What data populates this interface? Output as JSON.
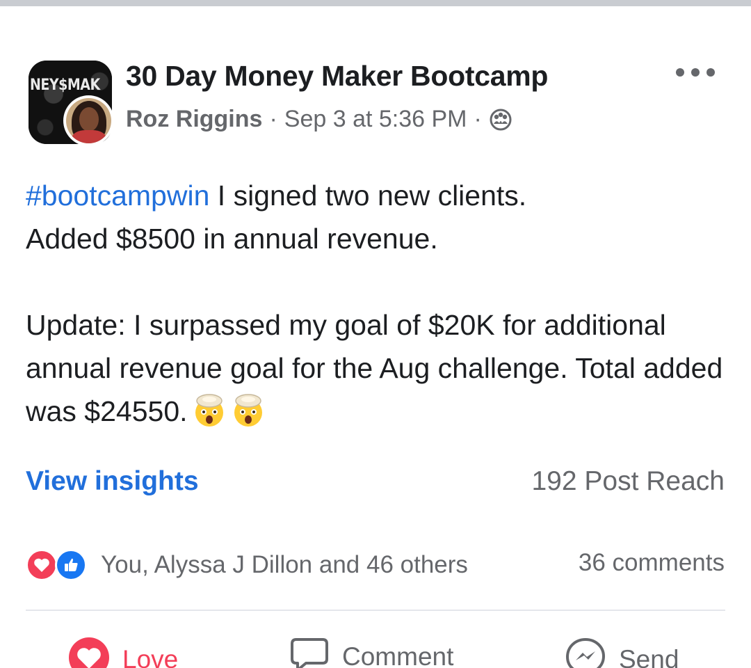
{
  "post": {
    "group_name": "30 Day Money Maker Bootcamp",
    "group_avatar_text": "NEY$MAK",
    "author": "Roz Riggins",
    "separator": "·",
    "timestamp": "Sep 3 at 5:36 PM",
    "privacy_icon": "group-icon",
    "hashtag": "#bootcampwin",
    "line1_rest": " I signed two new clients.",
    "line2": "Added $8500 in annual revenue.",
    "update_text": "Update: I surpassed my goal of $20K for additional annual revenue goal for the Aug challenge. Total added was $24550.",
    "emoji": [
      "exploding-head-emoji",
      "exploding-head-emoji"
    ]
  },
  "insights": {
    "link_label": "View insights",
    "post_reach": "192 Post Reach"
  },
  "reactions": {
    "icons": [
      "love-reaction-icon",
      "like-reaction-icon"
    ],
    "names": "You, Alyssa J Dillon and 46 others",
    "comments": "36 comments"
  },
  "actions": {
    "love": "Love",
    "comment": "Comment",
    "send": "Send"
  },
  "colors": {
    "accent_blue": "#216fdb",
    "love_red": "#f33e58",
    "like_blue": "#1877f2",
    "secondary_text": "#65676b"
  }
}
